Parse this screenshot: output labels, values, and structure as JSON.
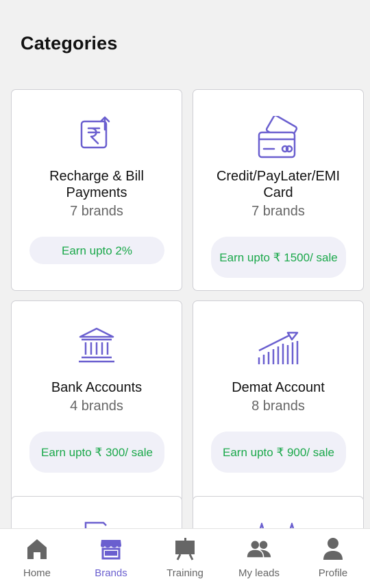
{
  "page": {
    "title": "Categories"
  },
  "colors": {
    "accent": "#6a5fcf",
    "earn_text": "#1aa84a",
    "earn_bg": "#f0f0f8"
  },
  "categories": [
    {
      "name": "Recharge & Bill Payments",
      "brands": "7 brands",
      "earn": "Earn upto 2%",
      "icon": "rupee-receipt-icon"
    },
    {
      "name": "Credit/PayLater/EMI Card",
      "brands": "7 brands",
      "earn": "Earn upto ₹ 1500/ sale",
      "icon": "credit-card-icon"
    },
    {
      "name": "Bank Accounts",
      "brands": "4 brands",
      "earn": "Earn upto ₹ 300/ sale",
      "icon": "bank-icon"
    },
    {
      "name": "Demat Account",
      "brands": "8 brands",
      "earn": "Earn upto ₹ 900/ sale",
      "icon": "growth-chart-icon"
    }
  ],
  "tabs": [
    {
      "label": "Home",
      "icon": "home-icon",
      "active": false
    },
    {
      "label": "Brands",
      "icon": "store-icon",
      "active": true
    },
    {
      "label": "Training",
      "icon": "easel-icon",
      "active": false
    },
    {
      "label": "My leads",
      "icon": "people-icon",
      "active": false
    },
    {
      "label": "Profile",
      "icon": "person-icon",
      "active": false
    }
  ]
}
